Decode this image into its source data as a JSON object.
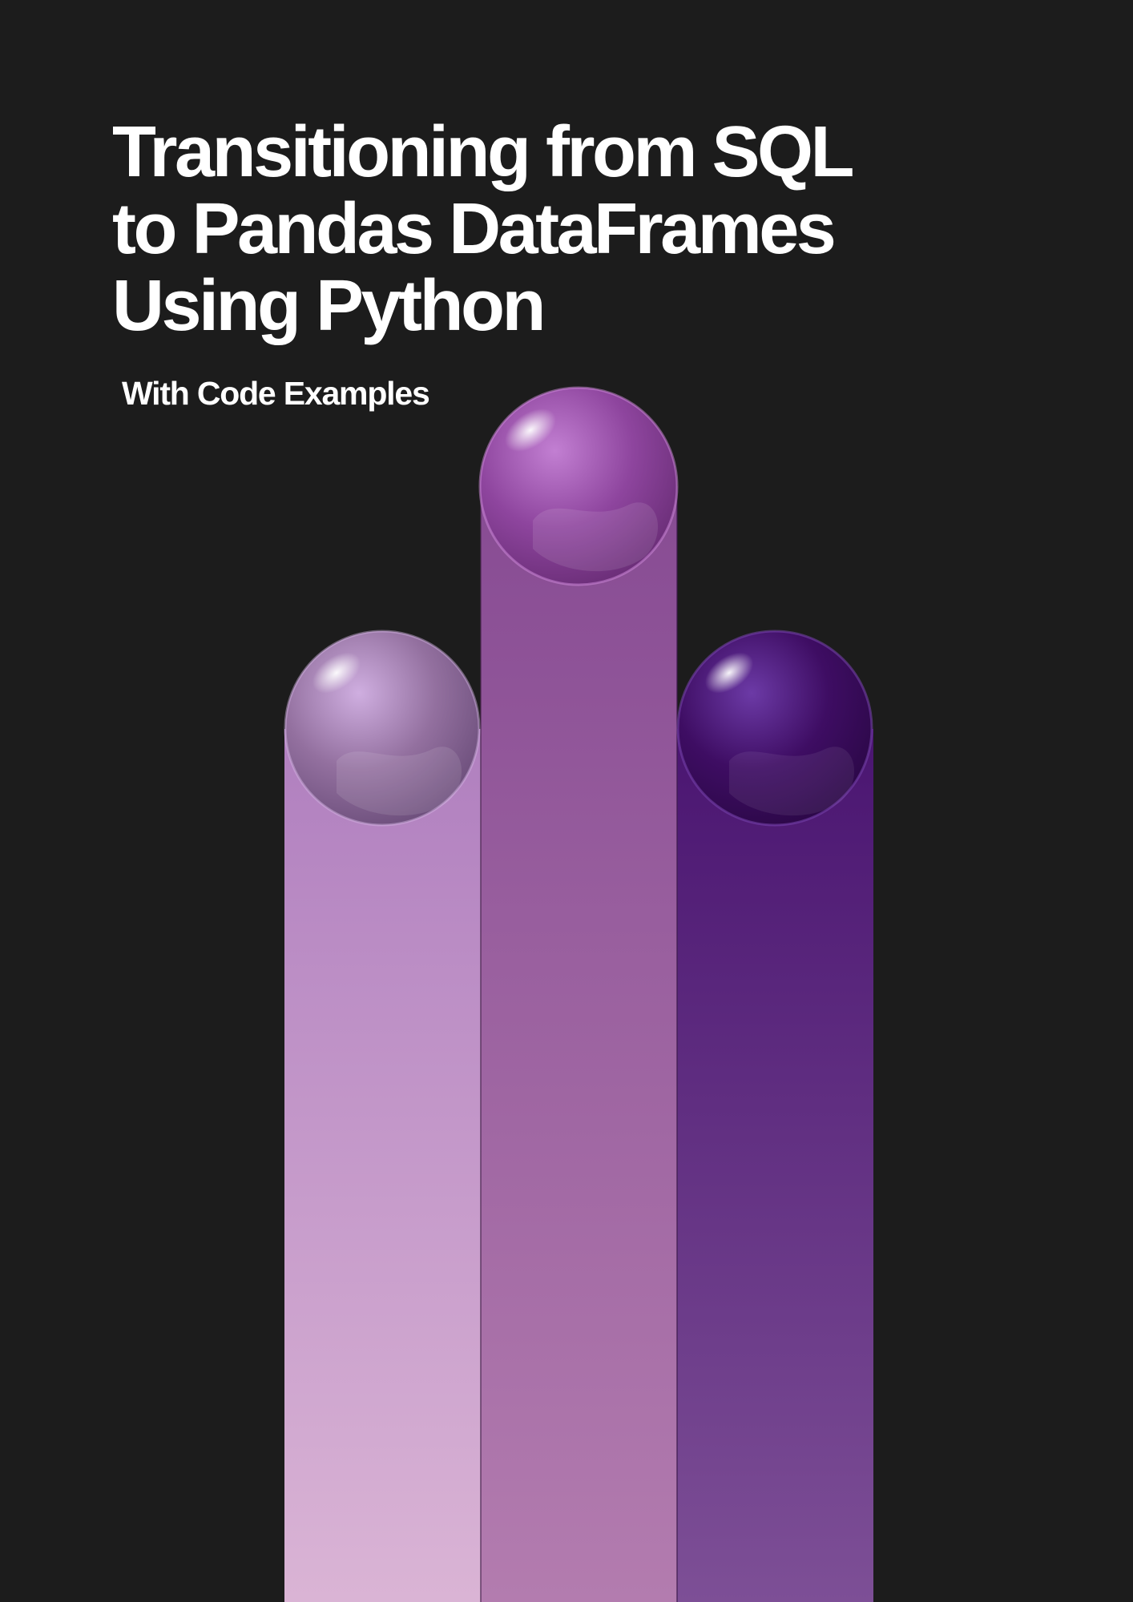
{
  "cover": {
    "title": "Transitioning from SQL\nto Pandas DataFrames\nUsing Python",
    "subtitle": "With Code Examples"
  },
  "colors": {
    "background": "#1c1c1c",
    "text": "#ffffff",
    "left_pillar": "#c899c6",
    "middle_pillar": "#9f5da2",
    "right_pillar": "#5b2482"
  }
}
